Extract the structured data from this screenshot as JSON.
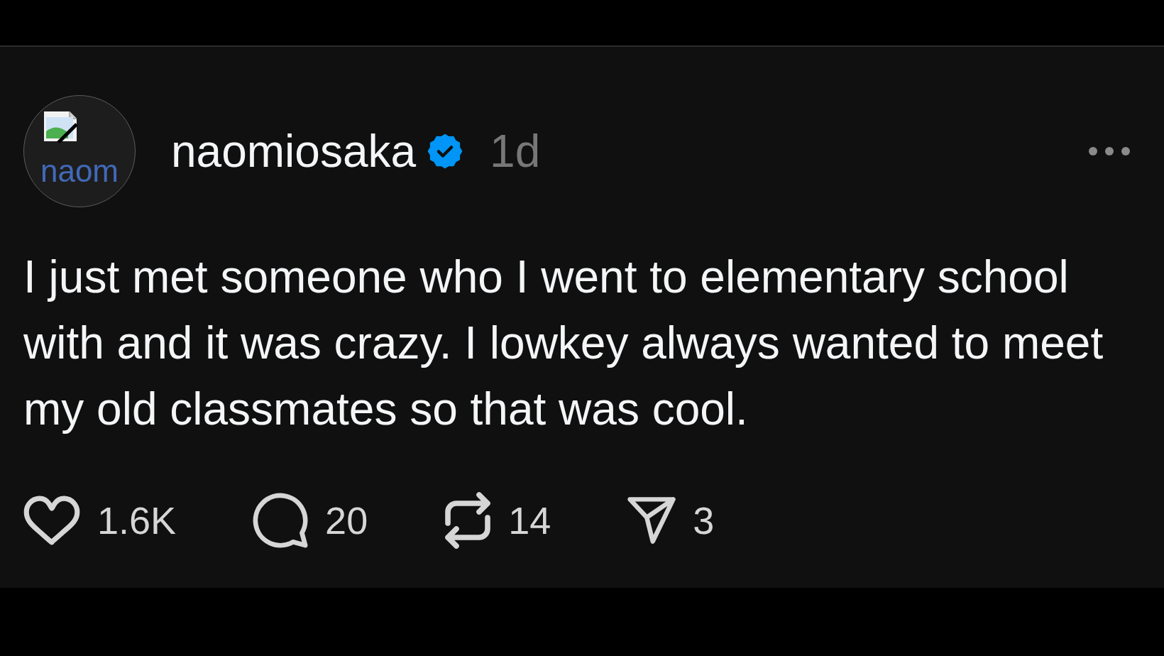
{
  "post": {
    "avatar": {
      "alt_text": "naom"
    },
    "username": "naomiosaka",
    "verified": true,
    "time": "1d",
    "text": "I just met someone who I went to elementary school with and it was crazy. I lowkey always wanted to meet my old classmates so that was cool.",
    "actions": [
      {
        "kind": "like",
        "count": "1.6K"
      },
      {
        "kind": "reply",
        "count": "20"
      },
      {
        "kind": "repost",
        "count": "14"
      },
      {
        "kind": "share",
        "count": "3"
      }
    ]
  }
}
